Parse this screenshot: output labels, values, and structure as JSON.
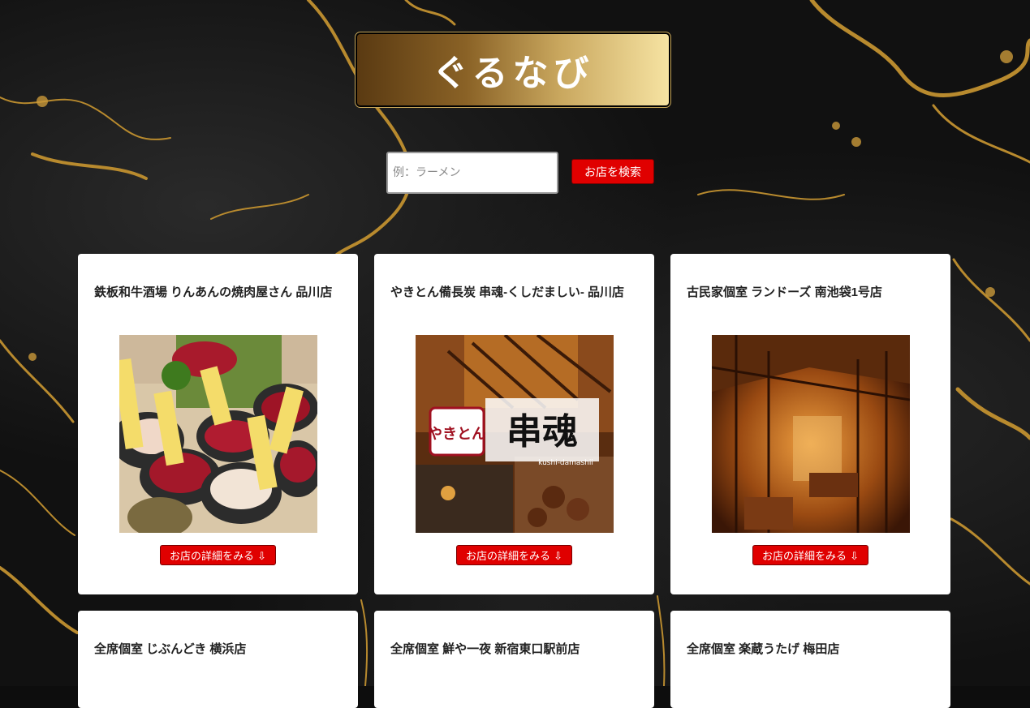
{
  "header": {
    "logo_text": "ぐるなび"
  },
  "search": {
    "placeholder": "例：ラーメン",
    "button_label": "お店を検索"
  },
  "restaurants": [
    {
      "name": "鉄板和牛酒場 りんあんの焼肉屋さん 品川店",
      "detail_label": "お店の詳細をみる ⇩"
    },
    {
      "name": "やきとん備長炭 串魂-くしだましい- 品川店",
      "detail_label": "お店の詳細をみる ⇩"
    },
    {
      "name": "古民家個室 ランドーズ 南池袋1号店",
      "detail_label": "お店の詳細をみる ⇩"
    },
    {
      "name": "全席個室 じぶんどき 横浜店"
    },
    {
      "name": "全席個室 鮮や一夜 新宿東口駅前店"
    },
    {
      "name": "全席個室 楽蔵うたげ 梅田店"
    }
  ],
  "photo_text": {
    "meat_tags": [
      "カイノミ",
      "上塩タン",
      "イチボ",
      "牛トロホルモン"
    ],
    "kushi_logo_main": "串魂",
    "kushi_logo_sub": "やきとん",
    "kushi_logo_roman": "kushi-damashii"
  },
  "colors": {
    "accent_red": "#e00000",
    "gold_light": "#f6e3a2",
    "gold_dark": "#5a3a12"
  }
}
